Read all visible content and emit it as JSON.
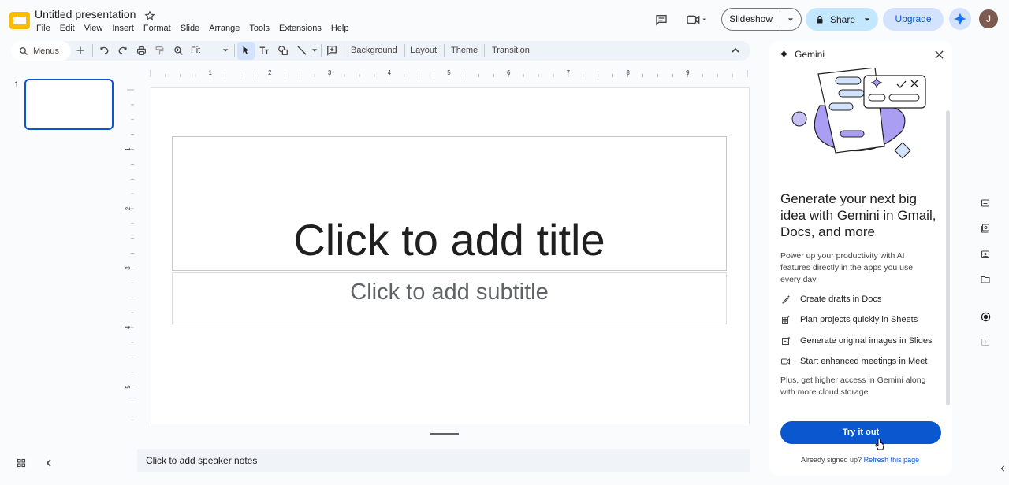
{
  "app": {
    "title": "Untitled presentation"
  },
  "menu": [
    "File",
    "Edit",
    "View",
    "Insert",
    "Format",
    "Slide",
    "Arrange",
    "Tools",
    "Extensions",
    "Help"
  ],
  "header": {
    "slideshow_label": "Slideshow",
    "share_label": "Share",
    "upgrade_label": "Upgrade",
    "avatar_initial": "J"
  },
  "toolbar": {
    "search_label": "Menus",
    "zoom_label": "Fit",
    "background_label": "Background",
    "layout_label": "Layout",
    "theme_label": "Theme",
    "transition_label": "Transition"
  },
  "filmstrip": {
    "slide_number": "1"
  },
  "ruler": {
    "h_marks": [
      "1",
      "2",
      "3",
      "4",
      "5",
      "6",
      "7",
      "8",
      "9"
    ],
    "v_marks": [
      "1",
      "2",
      "3",
      "4",
      "5"
    ]
  },
  "slide": {
    "title_placeholder": "Click to add title",
    "subtitle_placeholder": "Click to add subtitle"
  },
  "notes": {
    "placeholder": "Click to add speaker notes"
  },
  "gemini": {
    "panel_title": "Gemini",
    "headline": "Generate your next big idea with Gemini in Gmail, Docs, and more",
    "description": "Power up your productivity with AI features directly in the apps you use every day",
    "features": [
      {
        "label": "Create drafts in Docs",
        "icon": "pen-sparkle-icon"
      },
      {
        "label": "Plan projects quickly in Sheets",
        "icon": "table-sparkle-icon"
      },
      {
        "label": "Generate original images in Slides",
        "icon": "image-sparkle-icon"
      },
      {
        "label": "Start enhanced meetings in Meet",
        "icon": "video-icon"
      }
    ],
    "extra": "Plus, get higher access in Gemini along with more cloud storage",
    "cta_label": "Try it out",
    "signed_prefix": "Already signed up?",
    "refresh_label": "Refresh this page"
  },
  "colors": {
    "accent": "#0b57d0",
    "share_bg": "#c2e7ff",
    "toolbar_bg": "#eef2f9",
    "logo": "#fbbc04"
  }
}
